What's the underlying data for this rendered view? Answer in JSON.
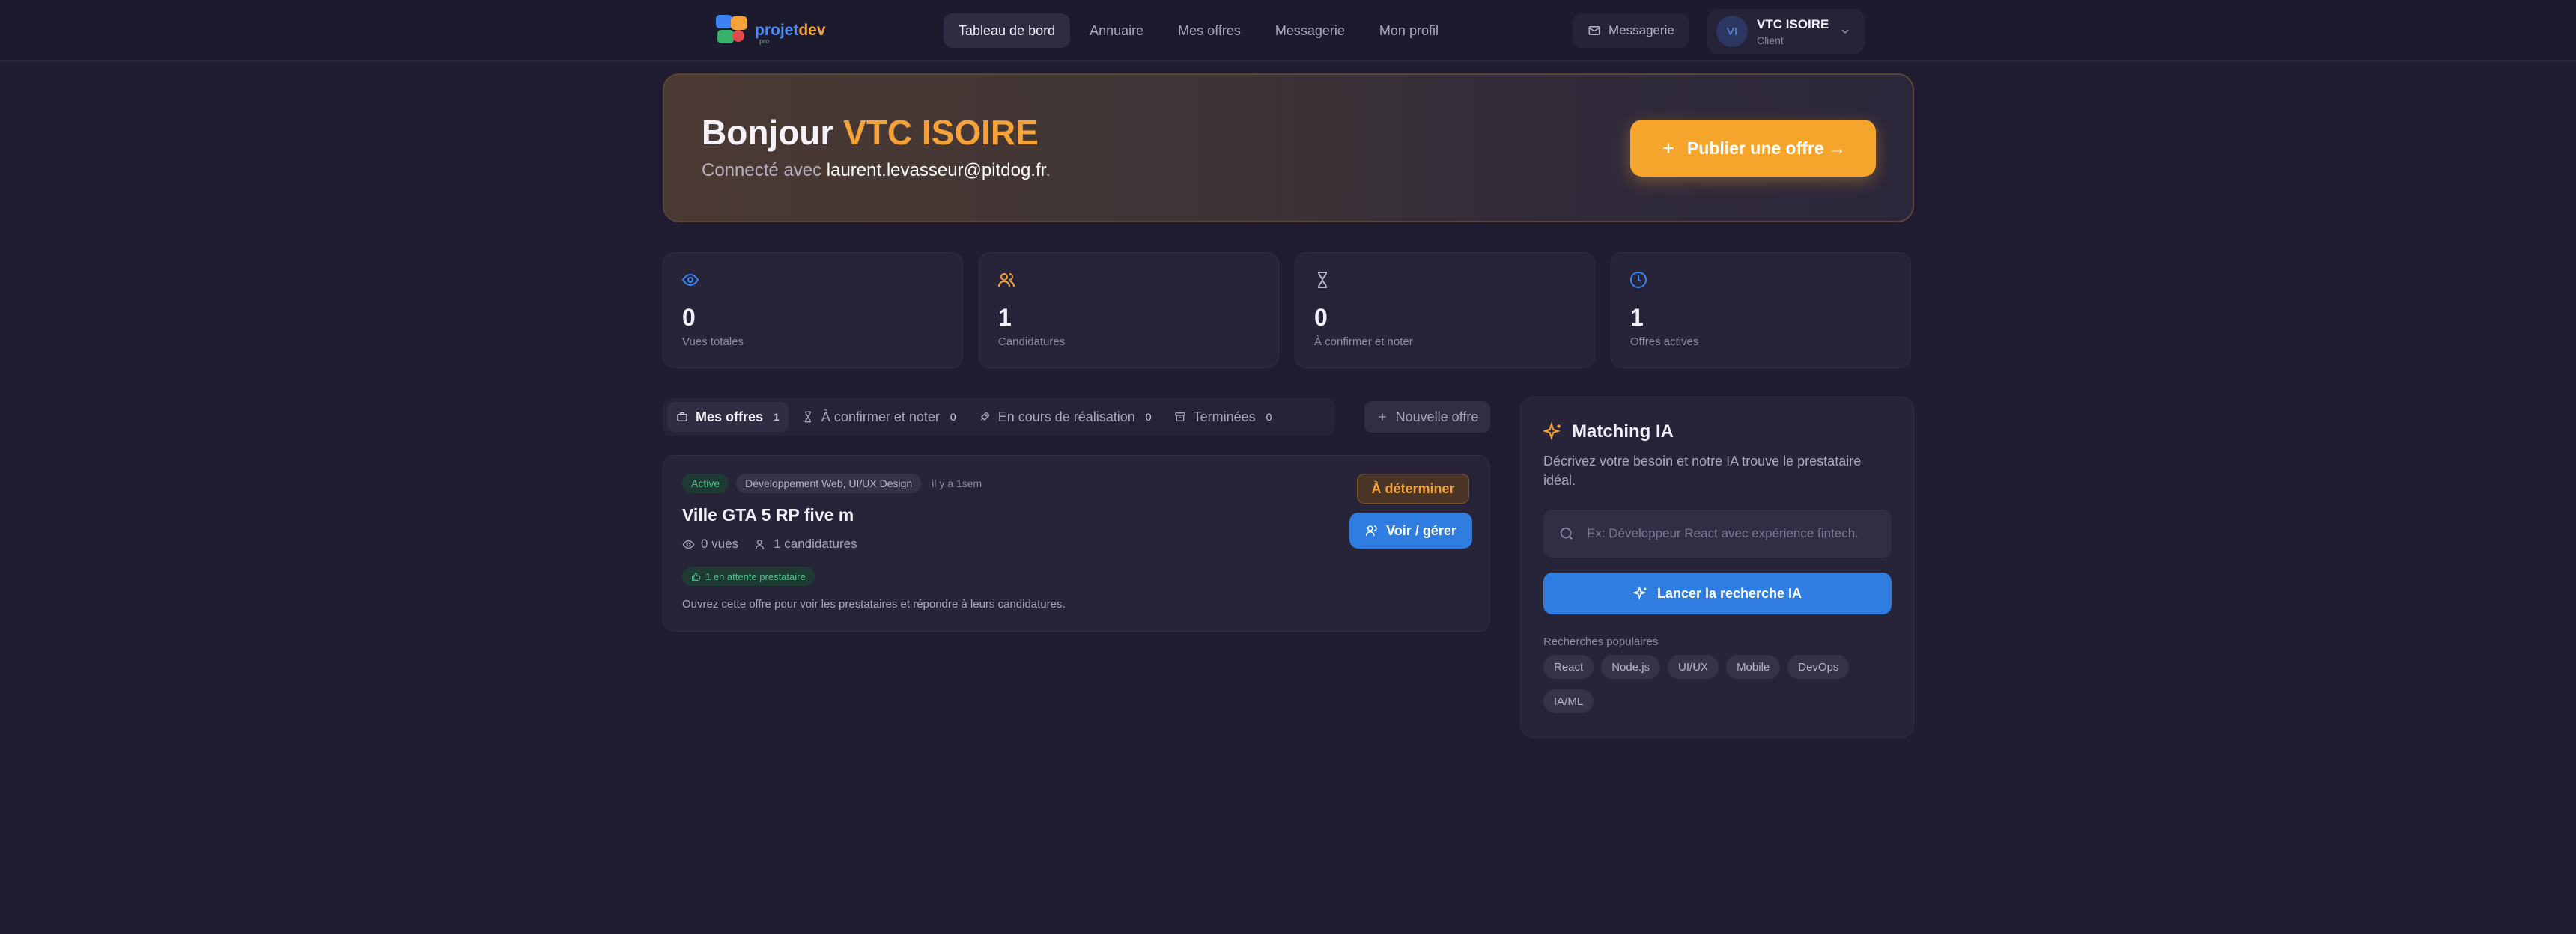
{
  "nav": {
    "logo": {
      "part1": "projet",
      "part2": "dev",
      "sub": "pro"
    },
    "links": [
      {
        "label": "Tableau de bord",
        "active": true
      },
      {
        "label": "Annuaire"
      },
      {
        "label": "Mes offres"
      },
      {
        "label": "Messagerie"
      },
      {
        "label": "Mon profil"
      }
    ],
    "messages_label": "Messagerie",
    "user": {
      "initials": "VI",
      "name": "VTC ISOIRE",
      "role": "Client"
    }
  },
  "hero": {
    "greeting": "Bonjour",
    "name": "VTC ISOIRE",
    "connected_prefix": "Connecté avec",
    "email": "laurent.levasseur@pitdog.fr",
    "email_suffix": ".",
    "publish_label": "Publier une offre →"
  },
  "stats": [
    {
      "value": "0",
      "label": "Vues totales",
      "icon": "eye-icon",
      "color": "#3b82f6"
    },
    {
      "value": "1",
      "label": "Candidatures",
      "icon": "users-icon",
      "color": "#f6a23a"
    },
    {
      "value": "0",
      "label": "À confirmer et noter",
      "icon": "hourglass-icon",
      "color": "#b6b2c8"
    },
    {
      "value": "1",
      "label": "Offres actives",
      "icon": "clock-icon",
      "color": "#3b82f6"
    }
  ],
  "tabs": [
    {
      "label": "Mes offres",
      "count": "1",
      "active": true
    },
    {
      "label": "À confirmer et noter",
      "count": "0"
    },
    {
      "label": "En cours de réalisation",
      "count": "0"
    },
    {
      "label": "Terminées",
      "count": "0"
    }
  ],
  "new_offer_label": "Nouvelle offre",
  "offer": {
    "status": "Active",
    "category": "Développement Web, UI/UX Design",
    "time": "il y a 1sem",
    "title": "Ville GTA 5 RP five m",
    "views": "0 vues",
    "candidates": "1 candidatures",
    "pending": "1 en attente prestataire",
    "note": "Ouvrez cette offre pour voir les prestataires et répondre à leurs candidatures.",
    "price": "À déterminer",
    "manage_label": "Voir / gérer"
  },
  "ia": {
    "title": "Matching IA",
    "description": "Décrivez votre besoin et notre IA trouve le prestataire idéal.",
    "placeholder": "Ex: Développeur React avec expérience fintech.",
    "button": "Lancer la recherche IA",
    "popular_label": "Recherches populaires",
    "chips": [
      "React",
      "Node.js",
      "UI/UX",
      "Mobile",
      "DevOps",
      "IA/ML"
    ]
  },
  "colors": {
    "accent_orange": "#f6a23a",
    "accent_blue": "#2f7de0",
    "background": "#201d33",
    "success": "#4bc18a"
  }
}
